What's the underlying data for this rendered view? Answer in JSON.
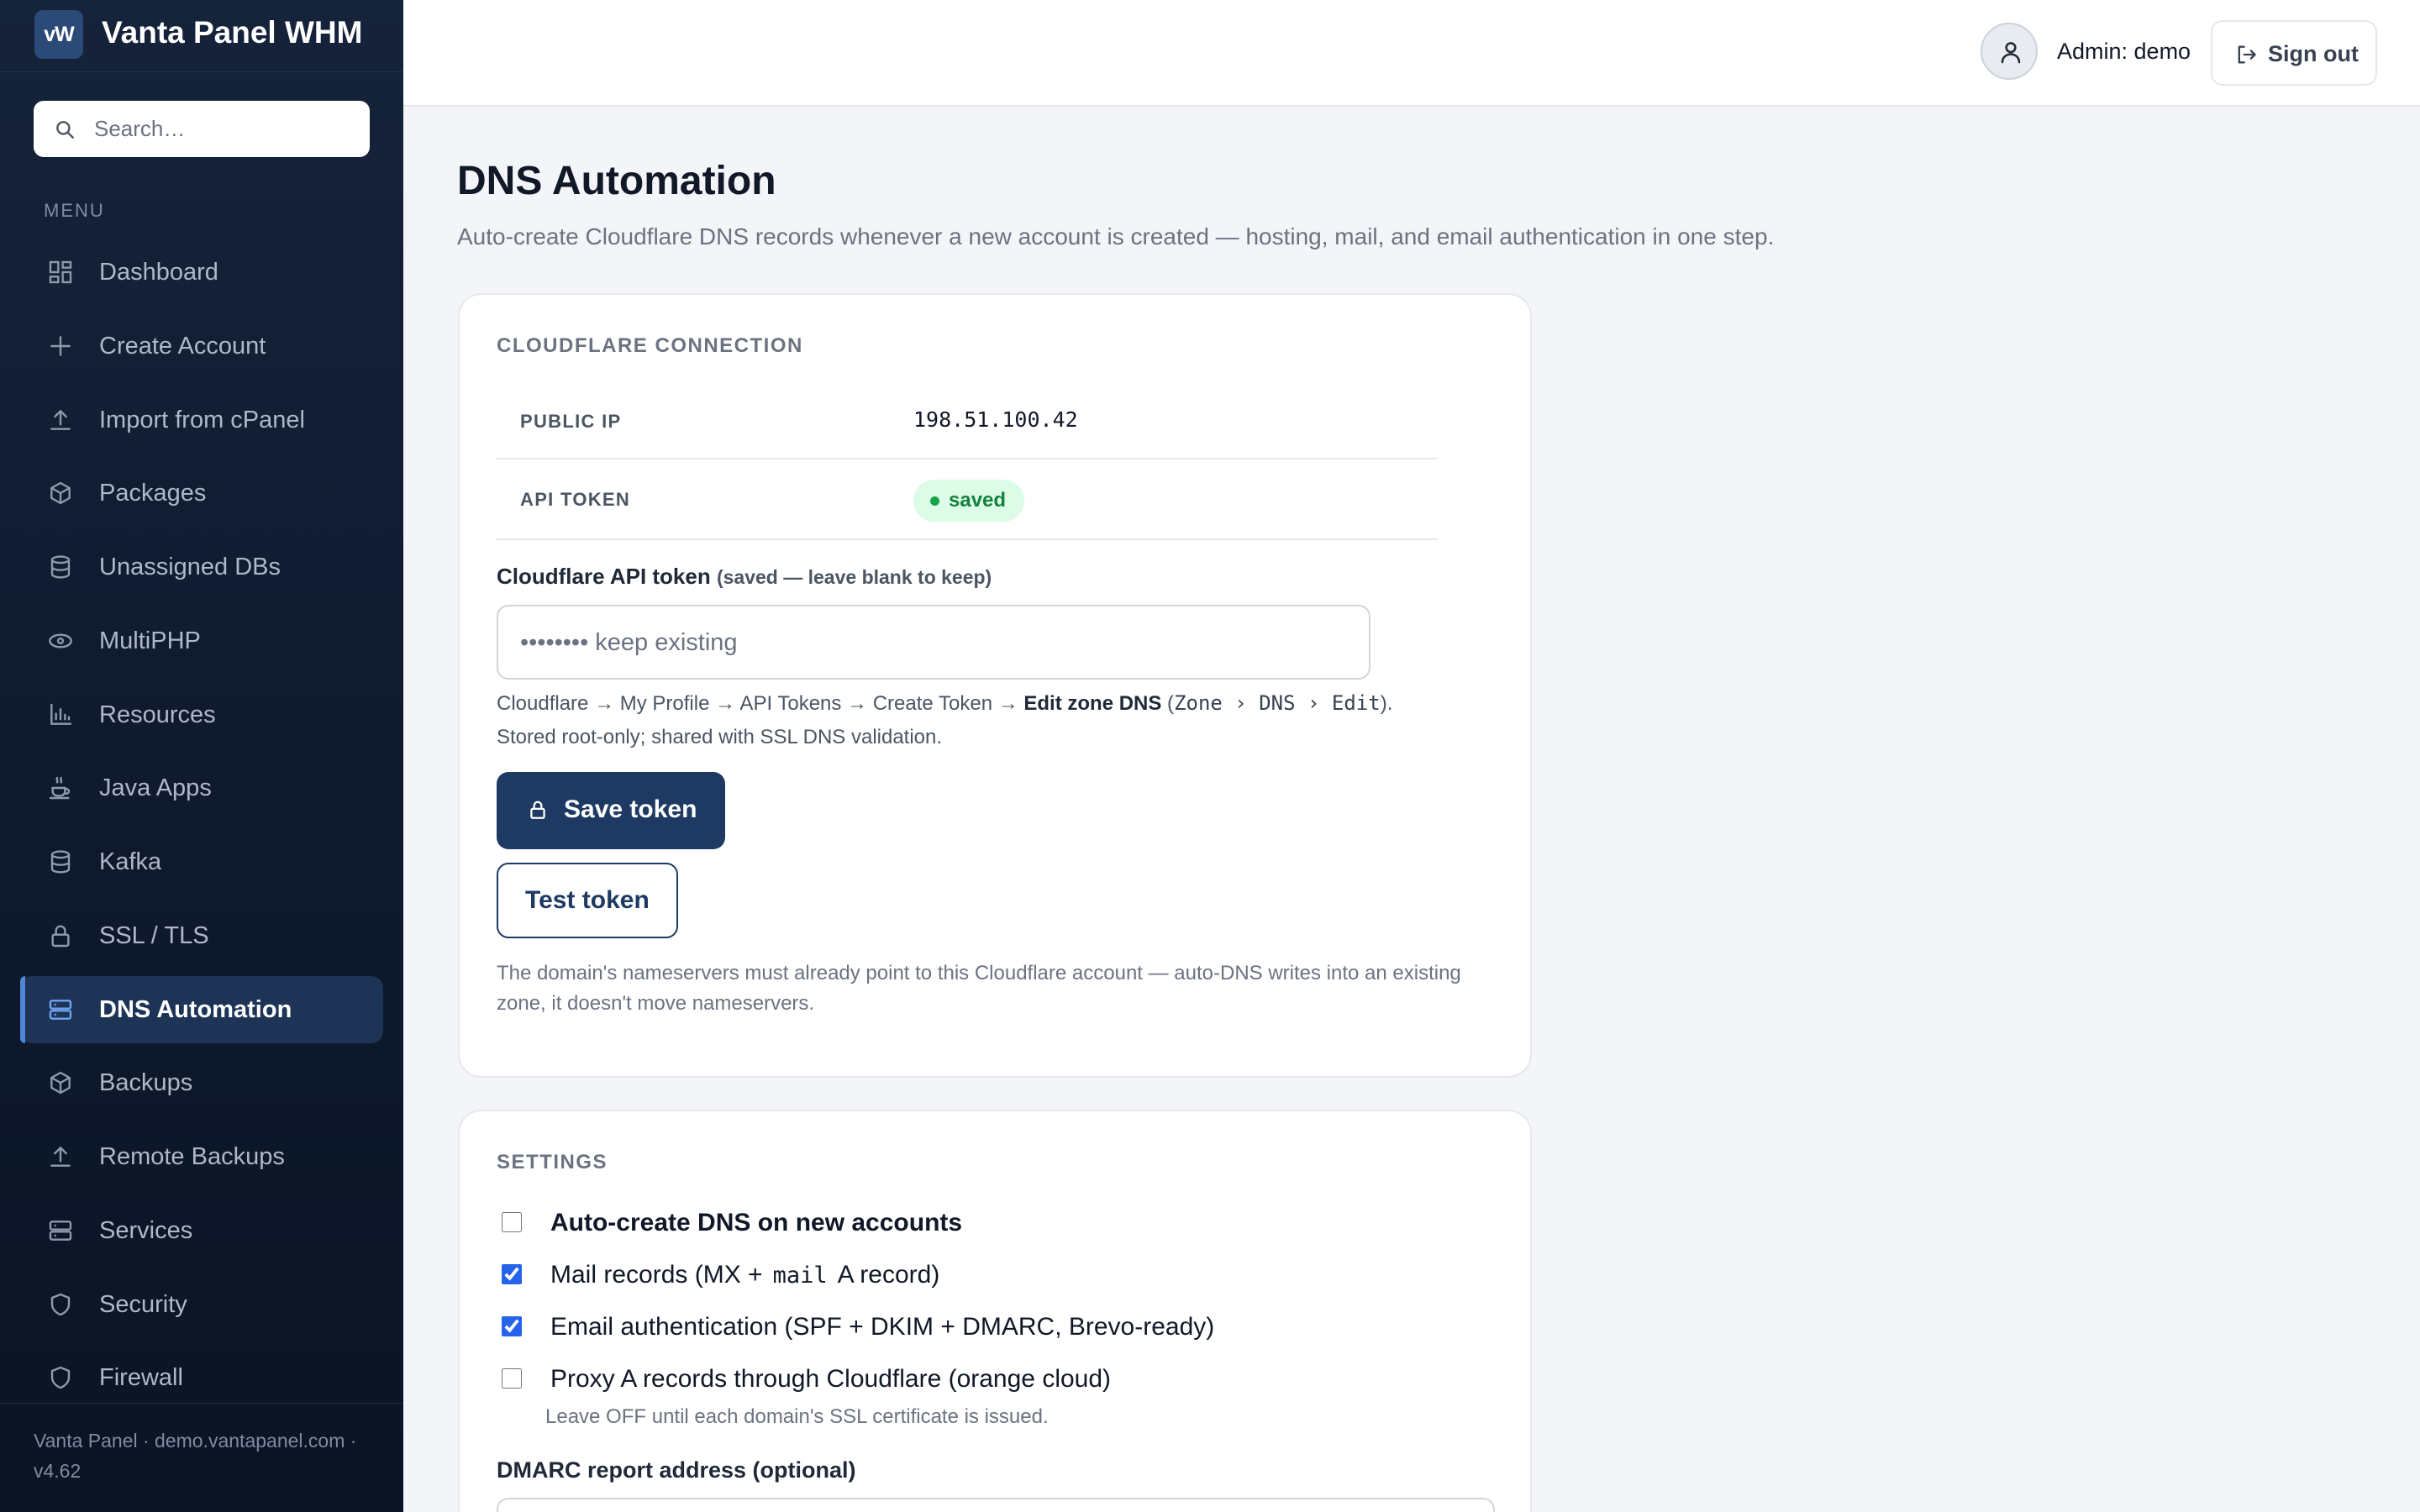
{
  "app": {
    "logo": "vW",
    "name": "Vanta Panel WHM"
  },
  "search": {
    "placeholder": "Search…"
  },
  "menu_label": "MENU",
  "nav": [
    {
      "label": "Dashboard",
      "icon": "dashboard-icon"
    },
    {
      "label": "Create Account",
      "icon": "plus-icon"
    },
    {
      "label": "Import from cPanel",
      "icon": "upload-icon"
    },
    {
      "label": "Packages",
      "icon": "package-icon"
    },
    {
      "label": "Unassigned DBs",
      "icon": "database-icon"
    },
    {
      "label": "MultiPHP",
      "icon": "php-icon"
    },
    {
      "label": "Resources",
      "icon": "bar-chart-icon"
    },
    {
      "label": "Java Apps",
      "icon": "coffee-icon"
    },
    {
      "label": "Kafka",
      "icon": "database-icon"
    },
    {
      "label": "SSL / TLS",
      "icon": "lock-icon"
    },
    {
      "label": "DNS Automation",
      "icon": "server-icon",
      "active": true
    },
    {
      "label": "Backups",
      "icon": "package-icon"
    },
    {
      "label": "Remote Backups",
      "icon": "upload-icon"
    },
    {
      "label": "Services",
      "icon": "server-icon"
    },
    {
      "label": "Security",
      "icon": "shield-icon"
    },
    {
      "label": "Firewall",
      "icon": "shield-icon"
    }
  ],
  "footer": {
    "text": "Vanta Panel · demo.vantapanel.com · v4.62"
  },
  "header": {
    "admin": "Admin: demo",
    "signout": "Sign out"
  },
  "page": {
    "title": "DNS Automation",
    "subtitle": "Auto-create Cloudflare DNS records whenever a new account is created — hosting, mail, and email authentication in one step."
  },
  "connection": {
    "heading": "CLOUDFLARE CONNECTION",
    "public_ip_label": "PUBLIC IP",
    "public_ip": "198.51.100.42",
    "api_token_label": "API TOKEN",
    "api_token_status": "saved",
    "field_label": "Cloudflare API token",
    "field_label_note": "(saved — leave blank to keep)",
    "token_placeholder": "•••••••• keep existing",
    "hint_path": "Cloudflare → My Profile → API Tokens → Create Token → ",
    "hint_bold": "Edit zone DNS",
    "hint_open": " (",
    "hint_code": "Zone › DNS › Edit",
    "hint_rest": "). Stored root-only; shared with SSL DNS validation.",
    "save_label": "Save token",
    "test_label": "Test token",
    "note": "The domain's nameservers must already point to this Cloudflare account — auto-DNS writes into an existing zone, it doesn't move nameservers."
  },
  "settings": {
    "heading": "SETTINGS",
    "auto_create_label": "Auto-create DNS on new accounts",
    "auto_create_checked": false,
    "mail_label_pre": "Mail records (MX +",
    "mail_label_code": "mail",
    "mail_label_post": "A record)",
    "mail_checked": true,
    "email_auth_label": "Email authentication (SPF + DKIM + DMARC, Brevo-ready)",
    "email_auth_checked": true,
    "proxy_label": "Proxy A records through Cloudflare (orange cloud)",
    "proxy_checked": false,
    "proxy_hint": "Leave OFF until each domain's SSL certificate is issued.",
    "dmarc_label": "DMARC report address (optional)"
  }
}
